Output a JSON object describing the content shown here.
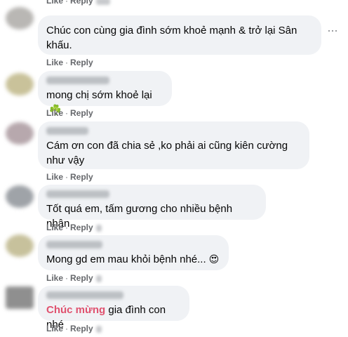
{
  "comments": [
    {
      "text": "Chúc con cùng gia đình sớm khoẻ mạnh & trở lại Sân khấu.",
      "avatar_color": "#b9b7b4",
      "actions": {
        "like": "Like",
        "reply": "Reply"
      }
    },
    {
      "text": "mong chị sớm khoẻ lại",
      "emoji": "☘️",
      "avatar_color": "#c9c29a",
      "actions": {
        "like": "Like",
        "reply": "Reply"
      }
    },
    {
      "text": "Cám ơn con đã chia sẻ ,ko phải ai cũng kiên cường như vậy",
      "avatar_color": "#b7a8ad",
      "actions": {
        "like": "Like",
        "reply": "Reply"
      }
    },
    {
      "text": "Tốt quá em, tấm gương cho nhiều bệnh nhân",
      "avatar_color": "#9fa3a8",
      "actions": {
        "like": "Like",
        "reply": "Reply"
      }
    },
    {
      "text": "Mong gd em mau khỏi bệnh nhé...",
      "emoji": "😍",
      "avatar_color": "#c7c19c",
      "actions": {
        "like": "Like",
        "reply": "Reply"
      }
    },
    {
      "highlight": "Chúc mừng",
      "text": " gia đình con nhé",
      "avatar_color": "#8f8f8f",
      "actions": {
        "like": "Like",
        "reply": "Reply"
      }
    }
  ],
  "more_icon": "ellipsis-icon",
  "dot_separator": "·"
}
